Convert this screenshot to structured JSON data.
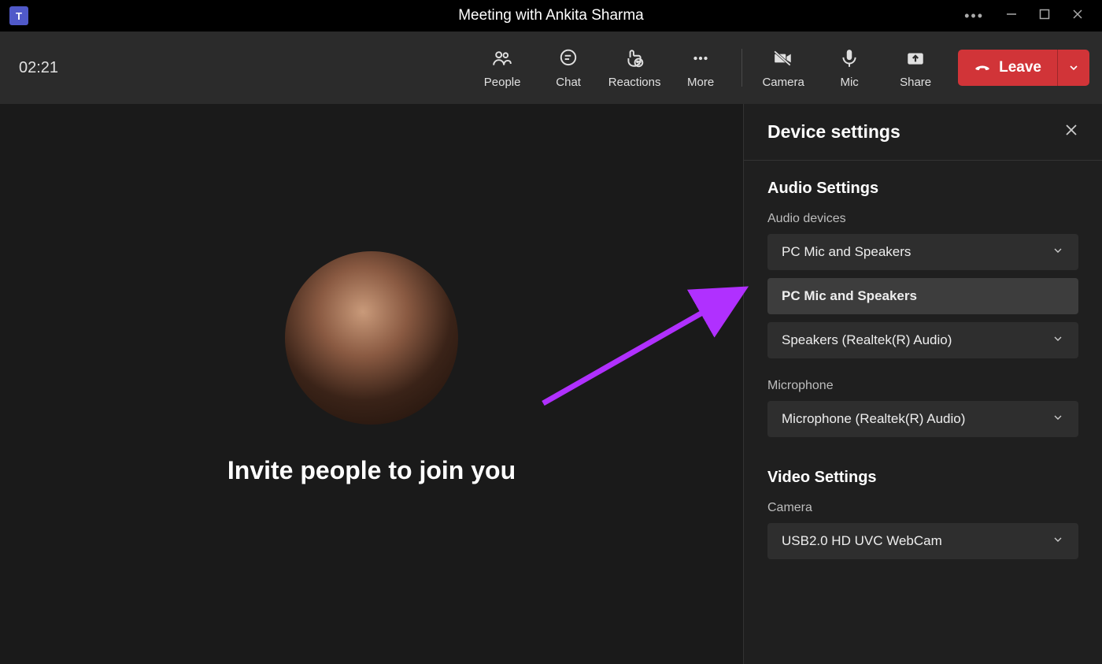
{
  "titlebar": {
    "meeting_title": "Meeting with Ankita Sharma"
  },
  "toolbar": {
    "timer": "02:21",
    "people_label": "People",
    "chat_label": "Chat",
    "reactions_label": "Reactions",
    "more_label": "More",
    "camera_label": "Camera",
    "mic_label": "Mic",
    "share_label": "Share",
    "leave_label": "Leave"
  },
  "stage": {
    "invite_text": "Invite people to join you"
  },
  "panel": {
    "title": "Device settings",
    "audio": {
      "heading": "Audio Settings",
      "devices_label": "Audio devices",
      "device_selected": "PC Mic and Speakers",
      "device_option_active": "PC Mic and Speakers",
      "speaker_selected": "Speakers (Realtek(R) Audio)",
      "mic_label": "Microphone",
      "mic_selected": "Microphone (Realtek(R) Audio)"
    },
    "video": {
      "heading": "Video Settings",
      "camera_label": "Camera",
      "camera_selected": "USB2.0 HD UVC WebCam"
    }
  }
}
